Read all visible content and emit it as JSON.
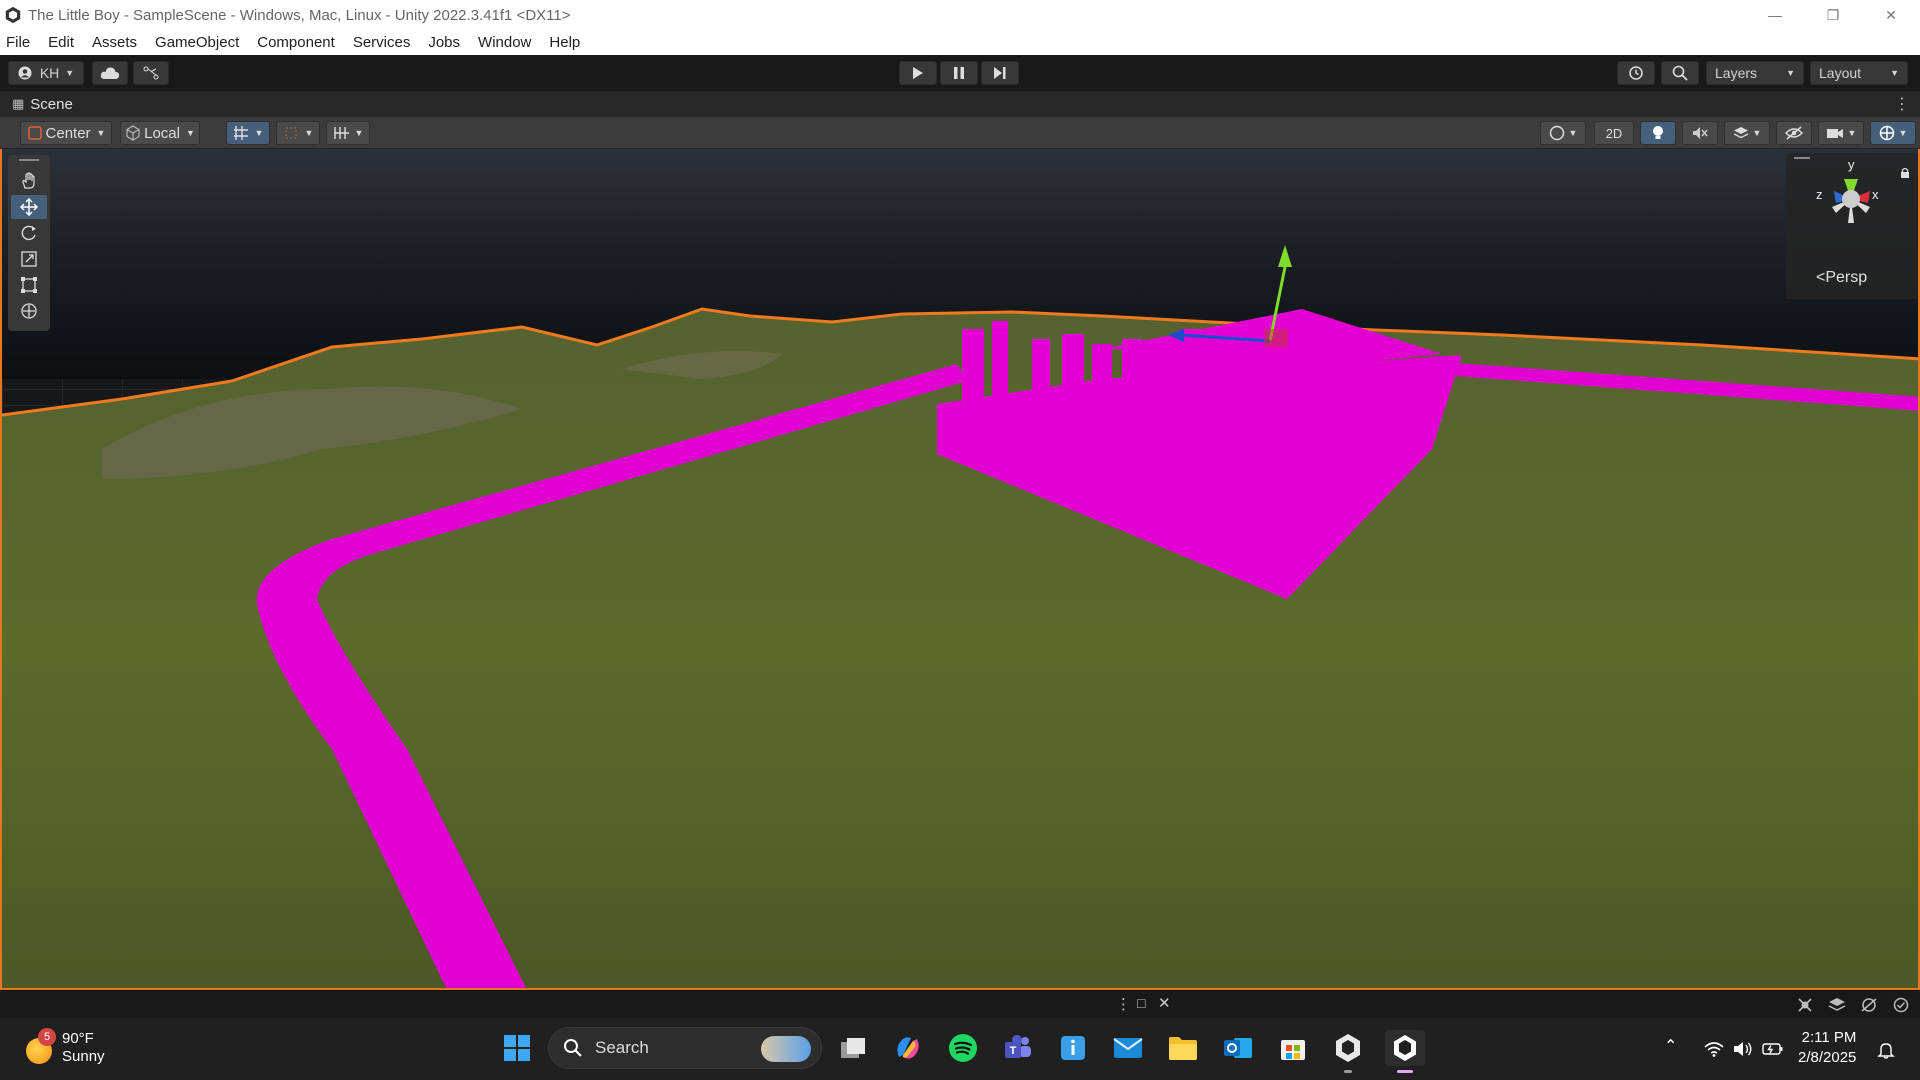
{
  "window": {
    "title": "The Little Boy - SampleScene - Windows, Mac, Linux - Unity 2022.3.41f1 <DX11>",
    "controls": [
      "minimize",
      "restore",
      "close"
    ]
  },
  "menu": [
    "File",
    "Edit",
    "Assets",
    "GameObject",
    "Component",
    "Services",
    "Jobs",
    "Window",
    "Help"
  ],
  "toolbar": {
    "account_label": "KH",
    "layers_label": "Layers",
    "layout_label": "Layout"
  },
  "scene_tab": {
    "label": "Scene"
  },
  "scene_toolbar": {
    "pivot_label": "Center",
    "space_label": "Local",
    "mode_2d_label": "2D"
  },
  "gizmo": {
    "y_label": "y",
    "x_label": "x",
    "z_label": "z",
    "projection_label": "Persp"
  },
  "colors": {
    "terrain": "#5a6529",
    "magenta": "#e400d4",
    "selection_outline": "#f07a1e",
    "sky": "#1c2024",
    "accent_active": "#46607c"
  },
  "taskbar": {
    "weather_badge": "5",
    "temperature": "90°F",
    "condition": "Sunny",
    "search_placeholder": "Search",
    "time": "2:11 PM",
    "date": "2/8/2025"
  }
}
